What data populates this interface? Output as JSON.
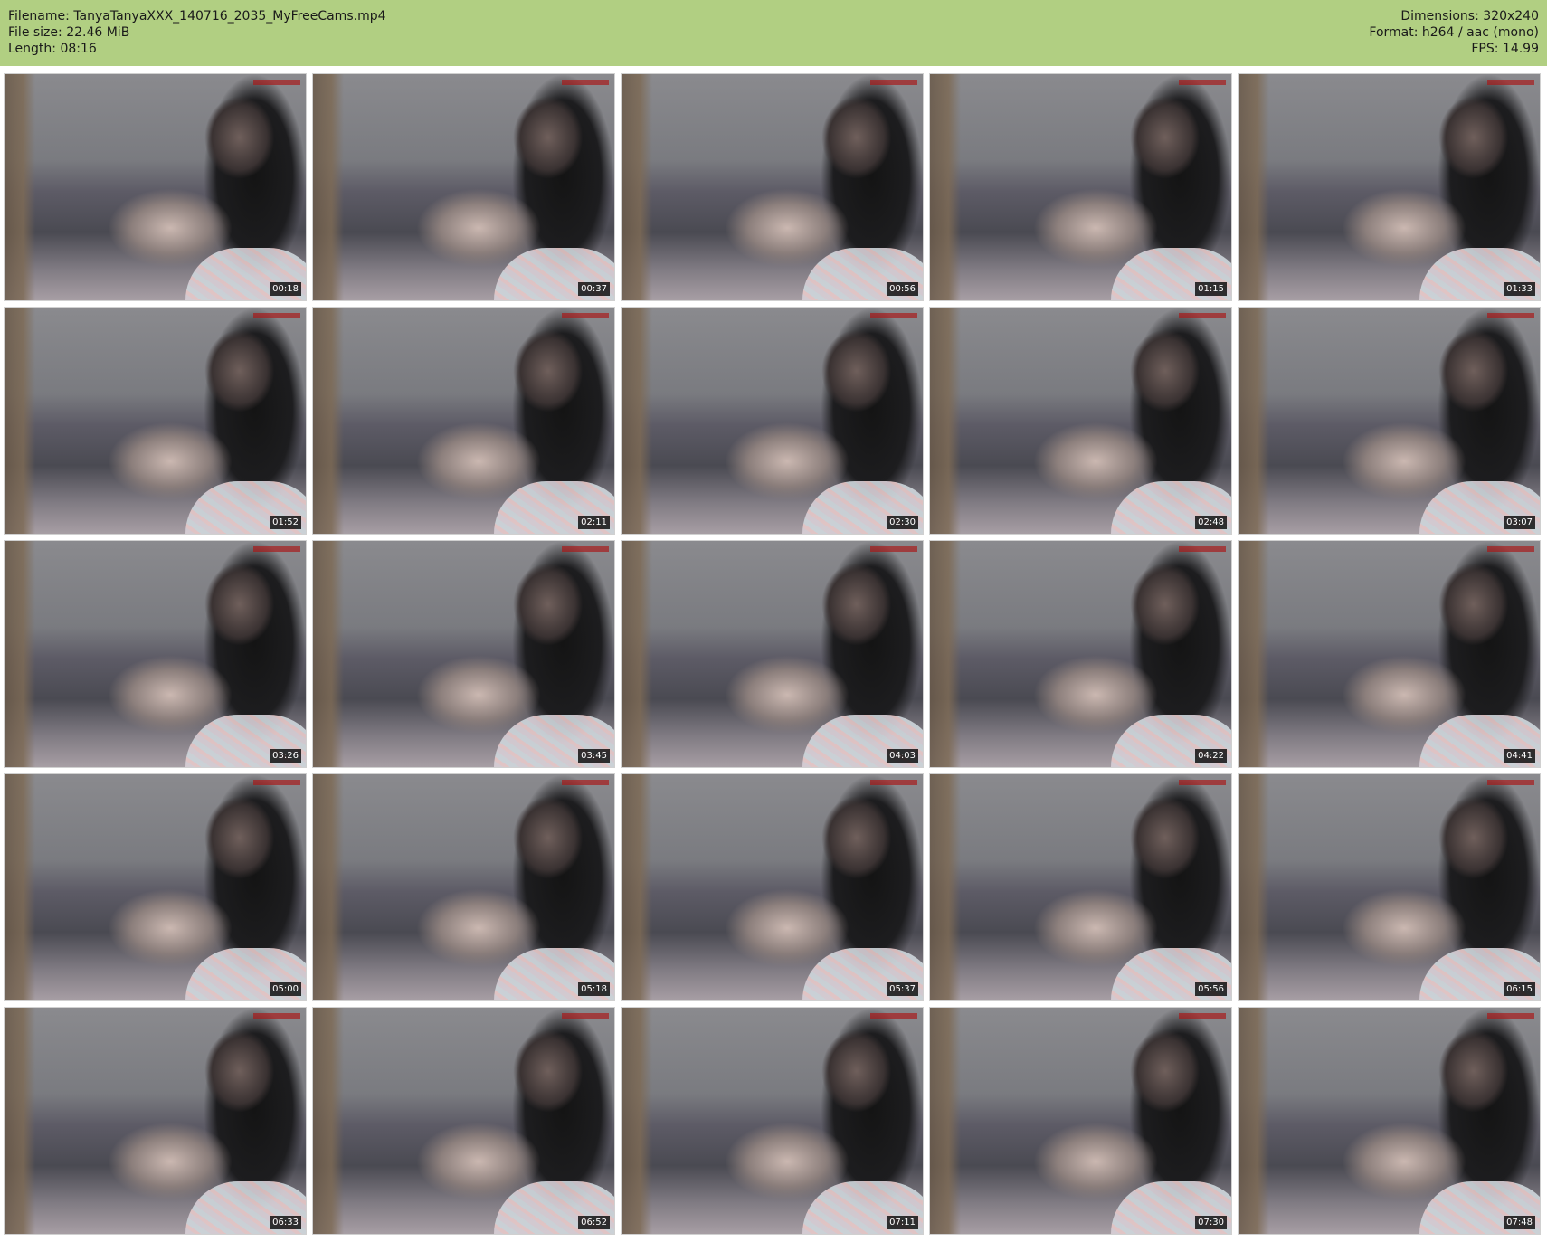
{
  "header": {
    "filename_label": "Filename:",
    "filename": "TanyaTanyaXXX_140716_2035_MyFreeCams.mp4",
    "filesize_label": "File size:",
    "filesize": "22.46 MiB",
    "length_label": "Length:",
    "length": "08:16",
    "dimensions_label": "Dimensions:",
    "dimensions": "320x240",
    "format_label": "Format:",
    "format": "h264 / aac (mono)",
    "fps_label": "FPS:",
    "fps": "14.99"
  },
  "colors": {
    "header_bg": "#b1cf82",
    "timestamp_bg": "#000000",
    "timestamp_text": "#ffffff"
  },
  "thumbnails": [
    "00:18",
    "00:37",
    "00:56",
    "01:15",
    "01:33",
    "01:52",
    "02:11",
    "02:30",
    "02:48",
    "03:07",
    "03:26",
    "03:45",
    "04:03",
    "04:22",
    "04:41",
    "05:00",
    "05:18",
    "05:37",
    "05:56",
    "06:15",
    "06:33",
    "06:52",
    "07:11",
    "07:30",
    "07:48"
  ]
}
